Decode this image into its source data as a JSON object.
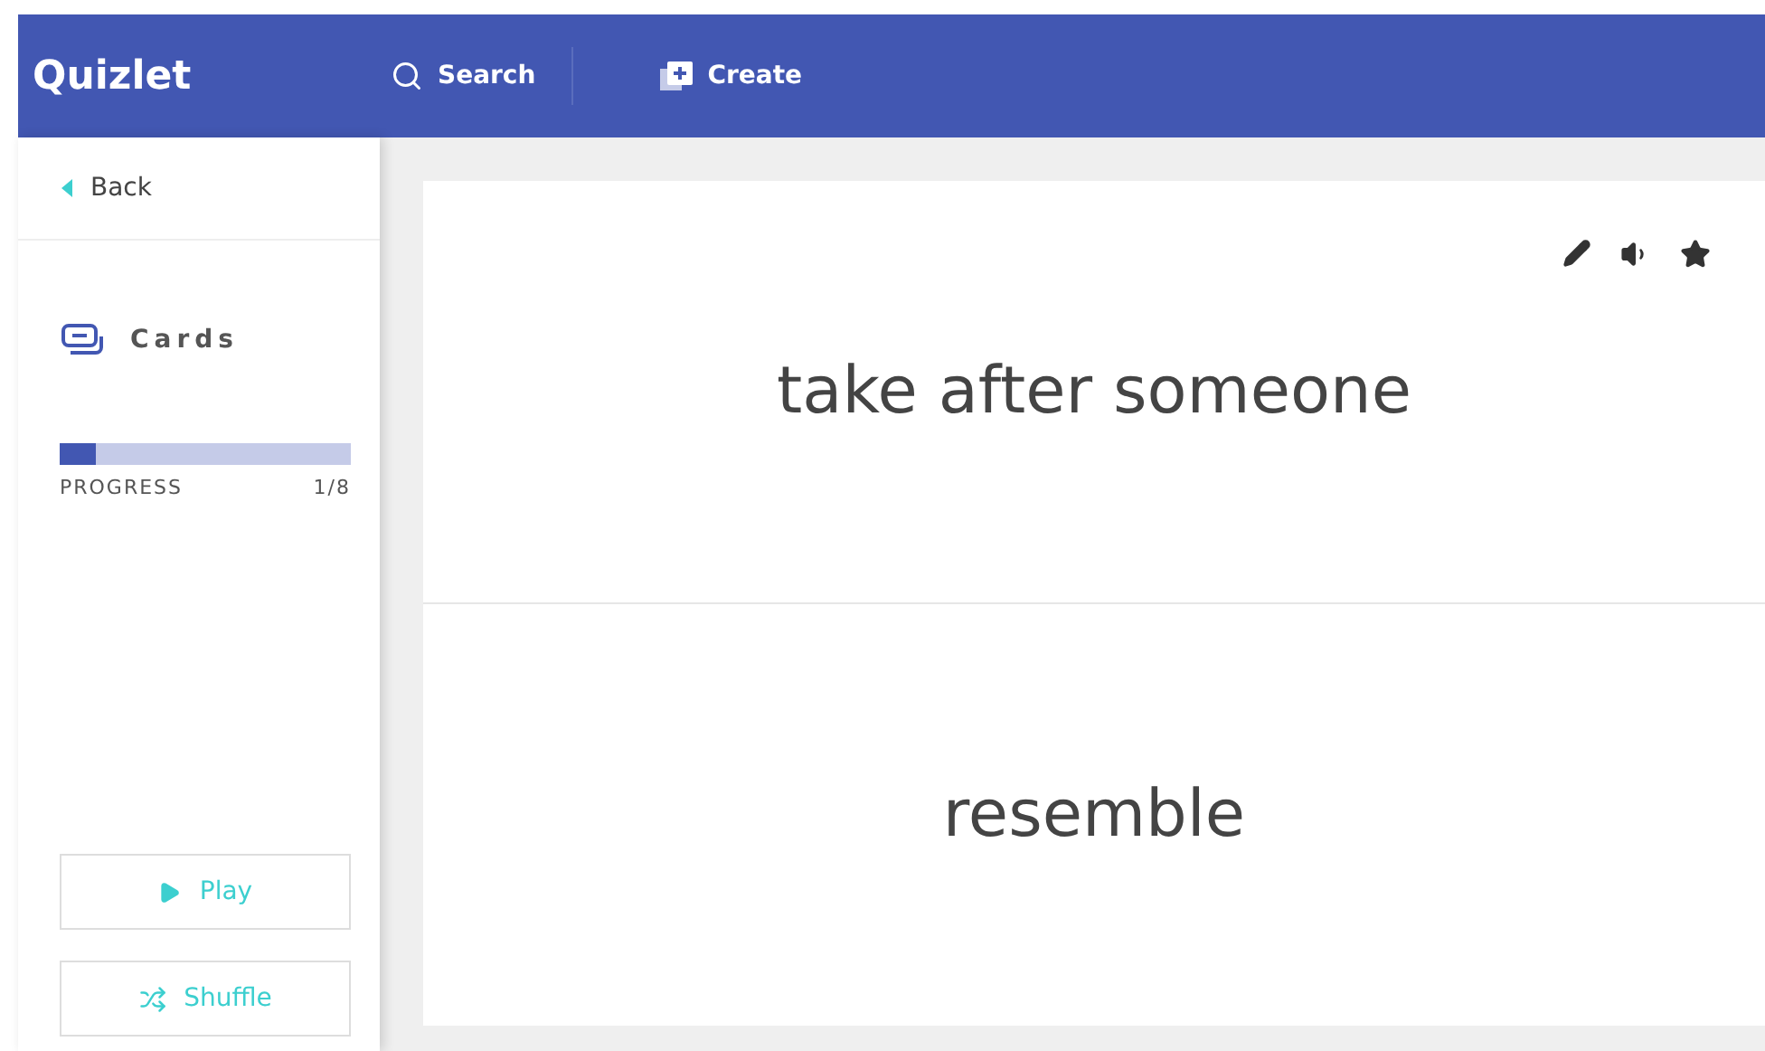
{
  "header": {
    "logo": "Quizlet",
    "nav": [
      {
        "kind": "search",
        "label": "Search"
      },
      {
        "kind": "create",
        "label": "Create"
      }
    ]
  },
  "sidebar": {
    "back": "Back",
    "mode": "Cards",
    "progress": {
      "label": "PROGRESS",
      "count": "1/8",
      "level": 0.125
    },
    "buttons": [
      {
        "kind": "play",
        "label": "Play"
      },
      {
        "kind": "shuffle",
        "label": "Shuffle"
      }
    ]
  },
  "card": {
    "term": "take after someone",
    "definition": "resemble",
    "starred": false
  }
}
